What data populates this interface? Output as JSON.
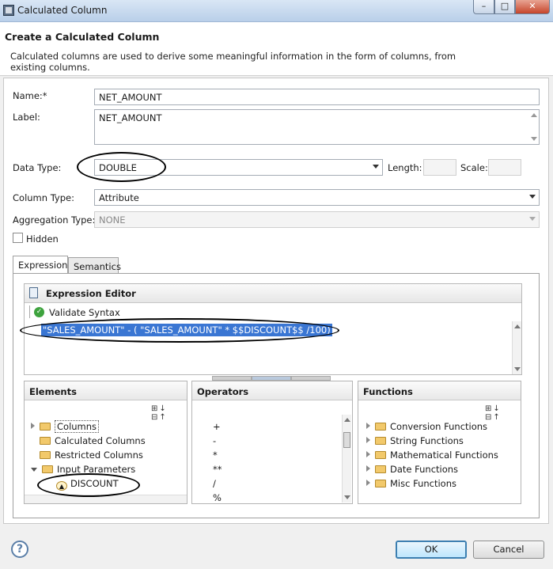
{
  "window": {
    "title": "Calculated Column",
    "min_label": "–",
    "max_label": "□",
    "close_label": "✕"
  },
  "header": {
    "title": "Create a Calculated Column",
    "description": "Calculated columns are used to derive some meaningful information in the form of columns, from existing columns."
  },
  "form": {
    "name_label": "Name:*",
    "name_value": "NET_AMOUNT",
    "label_label": "Label:",
    "label_value": "NET_AMOUNT",
    "data_type_label": "Data Type:",
    "data_type_value": "DOUBLE",
    "length_label": "Length:",
    "length_value": "",
    "scale_label": "Scale:",
    "scale_value": "",
    "column_type_label": "Column Type:",
    "column_type_value": "Attribute",
    "aggregation_type_label": "Aggregation Type:",
    "aggregation_type_value": "NONE",
    "hidden_label": "Hidden",
    "hidden_checked": false
  },
  "tabs": [
    {
      "label": "Expression",
      "active": true
    },
    {
      "label": "Semantics",
      "active": false
    }
  ],
  "expression_editor": {
    "title": "Expression Editor",
    "validate_label": "Validate Syntax",
    "expression": "\"SALES_AMOUNT\" - ( \"SALES_AMOUNT\" * $$DISCOUNT$$ /100)"
  },
  "elements_pane": {
    "title": "Elements",
    "tools": "⊞↓ ⊟↑",
    "items": [
      {
        "label": "Columns",
        "expander": "closed",
        "icon": "folder-icon",
        "selected": true
      },
      {
        "label": "Calculated Columns",
        "expander": "none",
        "icon": "folder-icon"
      },
      {
        "label": "Restricted Columns",
        "expander": "none",
        "icon": "folder-icon"
      },
      {
        "label": "Input Parameters",
        "expander": "open",
        "icon": "folder-icon"
      },
      {
        "label": "DISCOUNT",
        "expander": "none",
        "icon": "parameter-icon",
        "indent": 1
      }
    ]
  },
  "operators_pane": {
    "title": "Operators",
    "items": [
      "+",
      "-",
      "*",
      "**",
      "/",
      "%"
    ]
  },
  "functions_pane": {
    "title": "Functions",
    "tools": "⊞↓ ⊟↑",
    "items": [
      "Conversion Functions",
      "String Functions",
      "Mathematical Functions",
      "Date Functions",
      "Misc Functions"
    ]
  },
  "footer": {
    "help_label": "?",
    "ok_label": "OK",
    "cancel_label": "Cancel"
  },
  "colors": {
    "selection": "#3a76d3",
    "default_button_border": "#3c7fb1",
    "annotation_ellipse": "#000000"
  }
}
